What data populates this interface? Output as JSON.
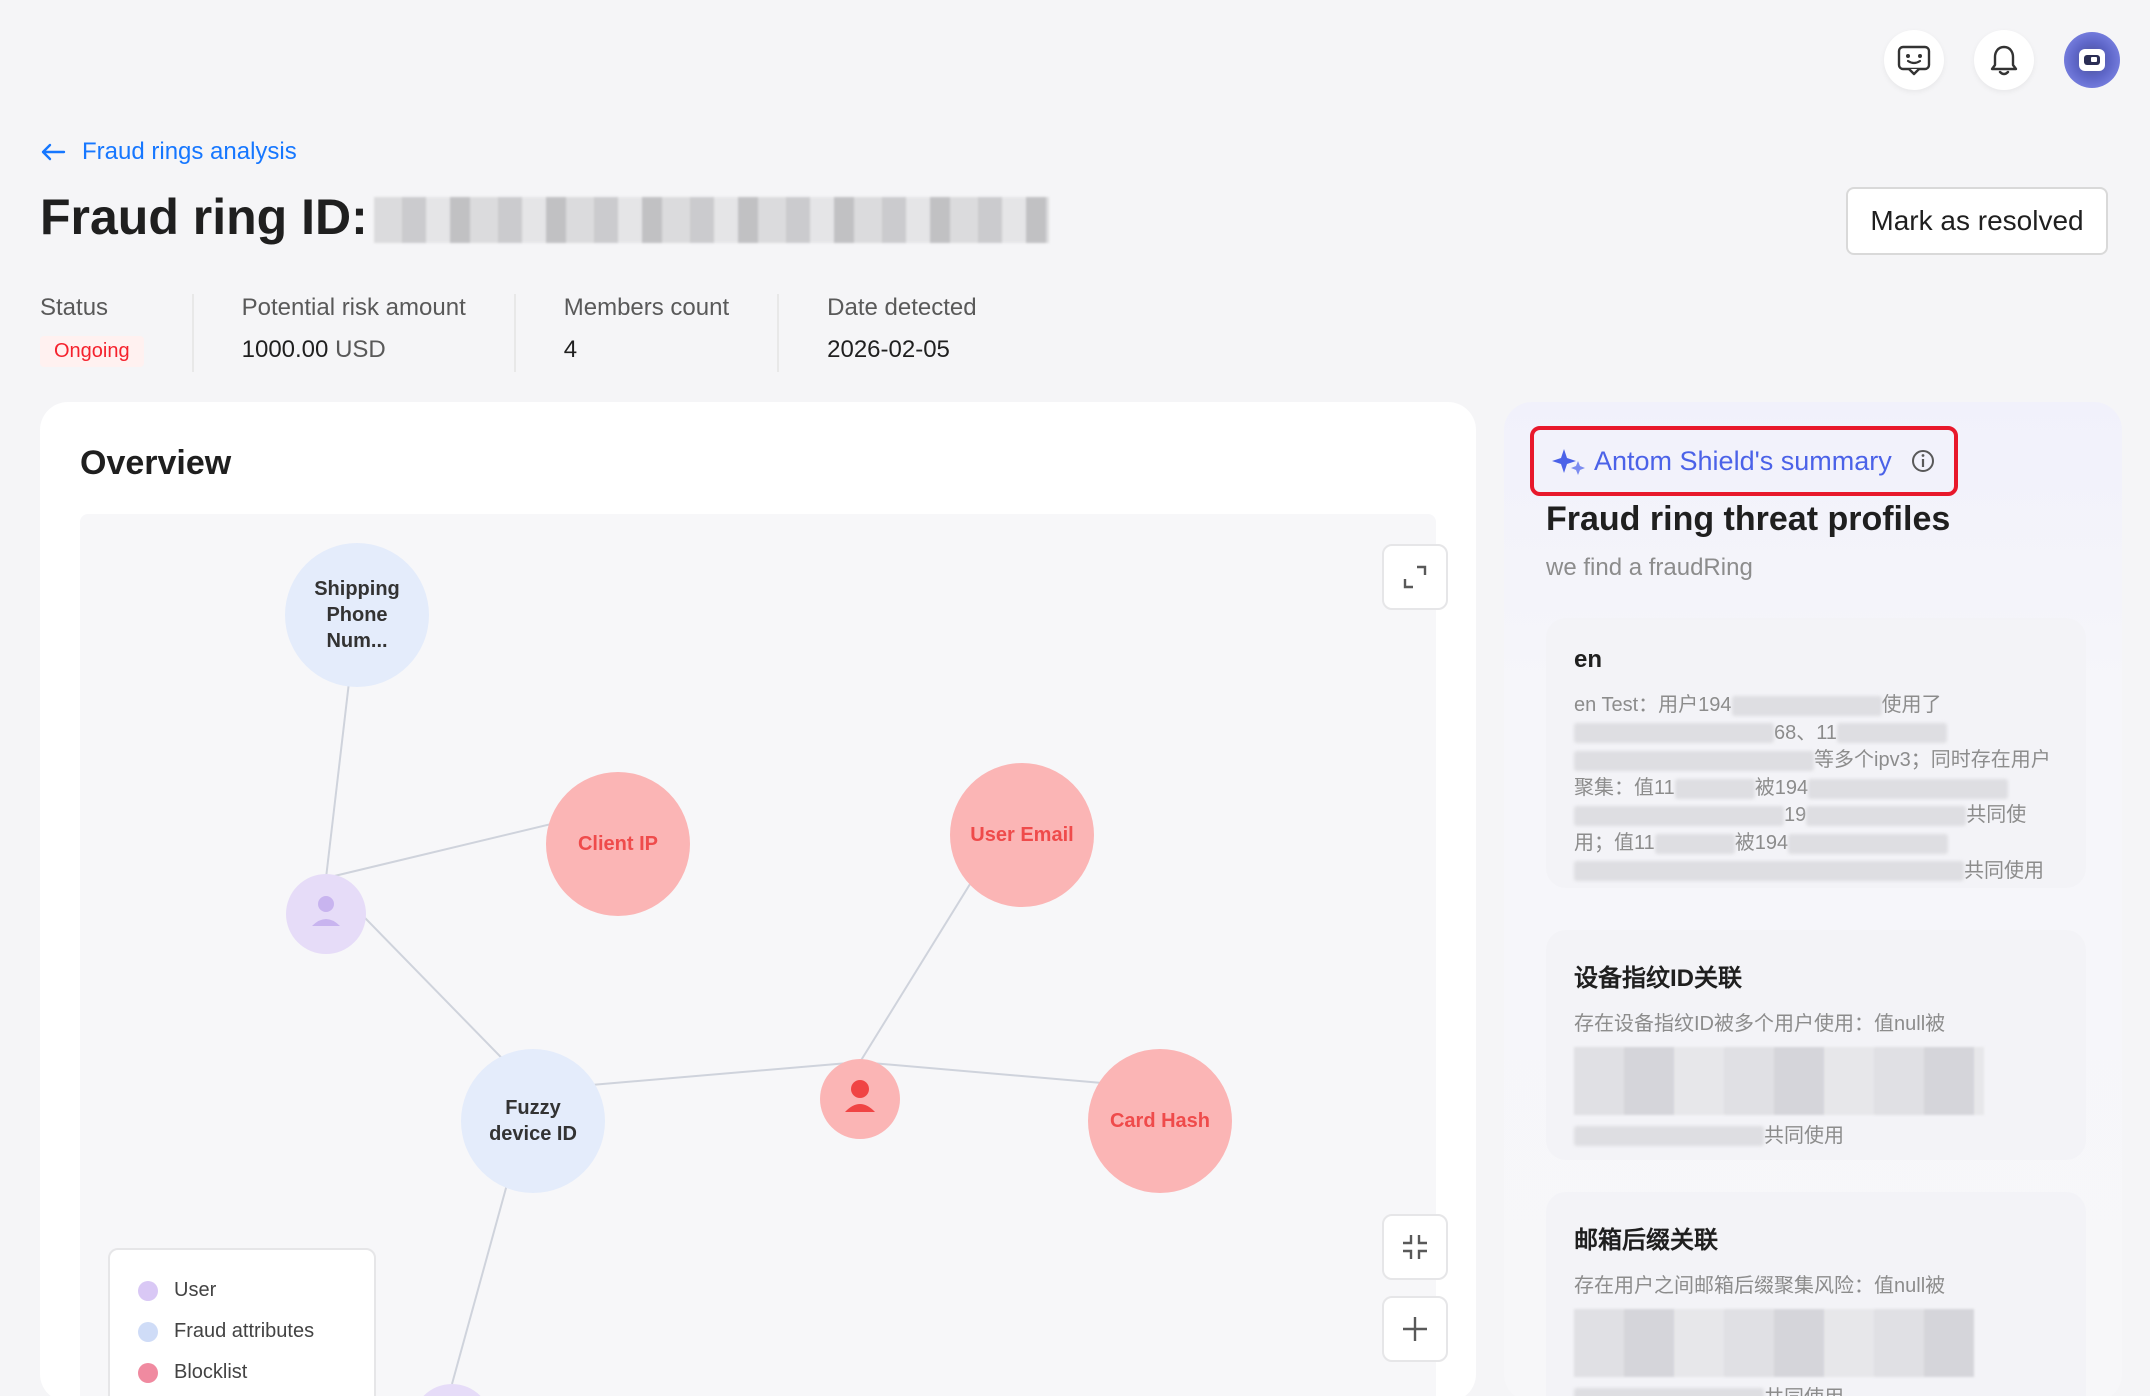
{
  "header": {
    "back_label": "Fraud rings analysis",
    "title": "Fraud ring ID:",
    "resolve_button": "Mark as resolved"
  },
  "icons": {
    "feedback": "message-face-icon",
    "notifications": "bell-icon",
    "avatar": "robot-avatar-icon",
    "back": "arrow-left-icon",
    "sparkle": "sparkle-icon",
    "info": "info-icon",
    "expand": "expand-icon",
    "shrink": "collapse-icon",
    "zoom_in": "plus-icon"
  },
  "stats": [
    {
      "label": "Status",
      "value": "Ongoing"
    },
    {
      "label": "Potential risk amount",
      "value": "1000.00",
      "unit": "USD"
    },
    {
      "label": "Members count",
      "value": "4"
    },
    {
      "label": "Date detected",
      "value": "2026-02-05"
    }
  ],
  "overview": {
    "title": "Overview",
    "nodes": {
      "shipping_phone": "Shipping Phone Num...",
      "client_ip": "Client IP",
      "user_email": "User Email",
      "fuzzy_device": "Fuzzy device ID",
      "card_hash": "Card Hash"
    },
    "legend": [
      {
        "label": "User",
        "color": "#d9c8f5"
      },
      {
        "label": "Fraud attributes",
        "color": "#cfdcf7"
      },
      {
        "label": "Blocklist",
        "color": "#f08aa0"
      }
    ]
  },
  "summary": {
    "badge": "Antom Shield's summary",
    "heading": "Fraud ring threat profiles",
    "subtitle": "we find a fraudRing",
    "cards": [
      {
        "title": "en",
        "line1_prefix": "en Test：用户194",
        "line1_suffix": "使用了",
        "line2": "68、11",
        "line3": "等多个ipv3；同时存在用户",
        "line4_prefix": "聚集：值11",
        "line4_mid": "被194",
        "line5_mid": "19",
        "line5_suffix": "共同使",
        "line6_prefix": "用；值11",
        "line6_mid": "被194",
        "line7_suffix": "共同使用"
      },
      {
        "title": "设备指纹ID关联",
        "line1": "存在设备指纹ID被多个用户使用：值null被",
        "line_end": "共同使用"
      },
      {
        "title": "邮箱后缀关联",
        "line1": "存在用户之间邮箱后缀聚集风险：值null被",
        "line_end": "共同使用"
      }
    ]
  }
}
